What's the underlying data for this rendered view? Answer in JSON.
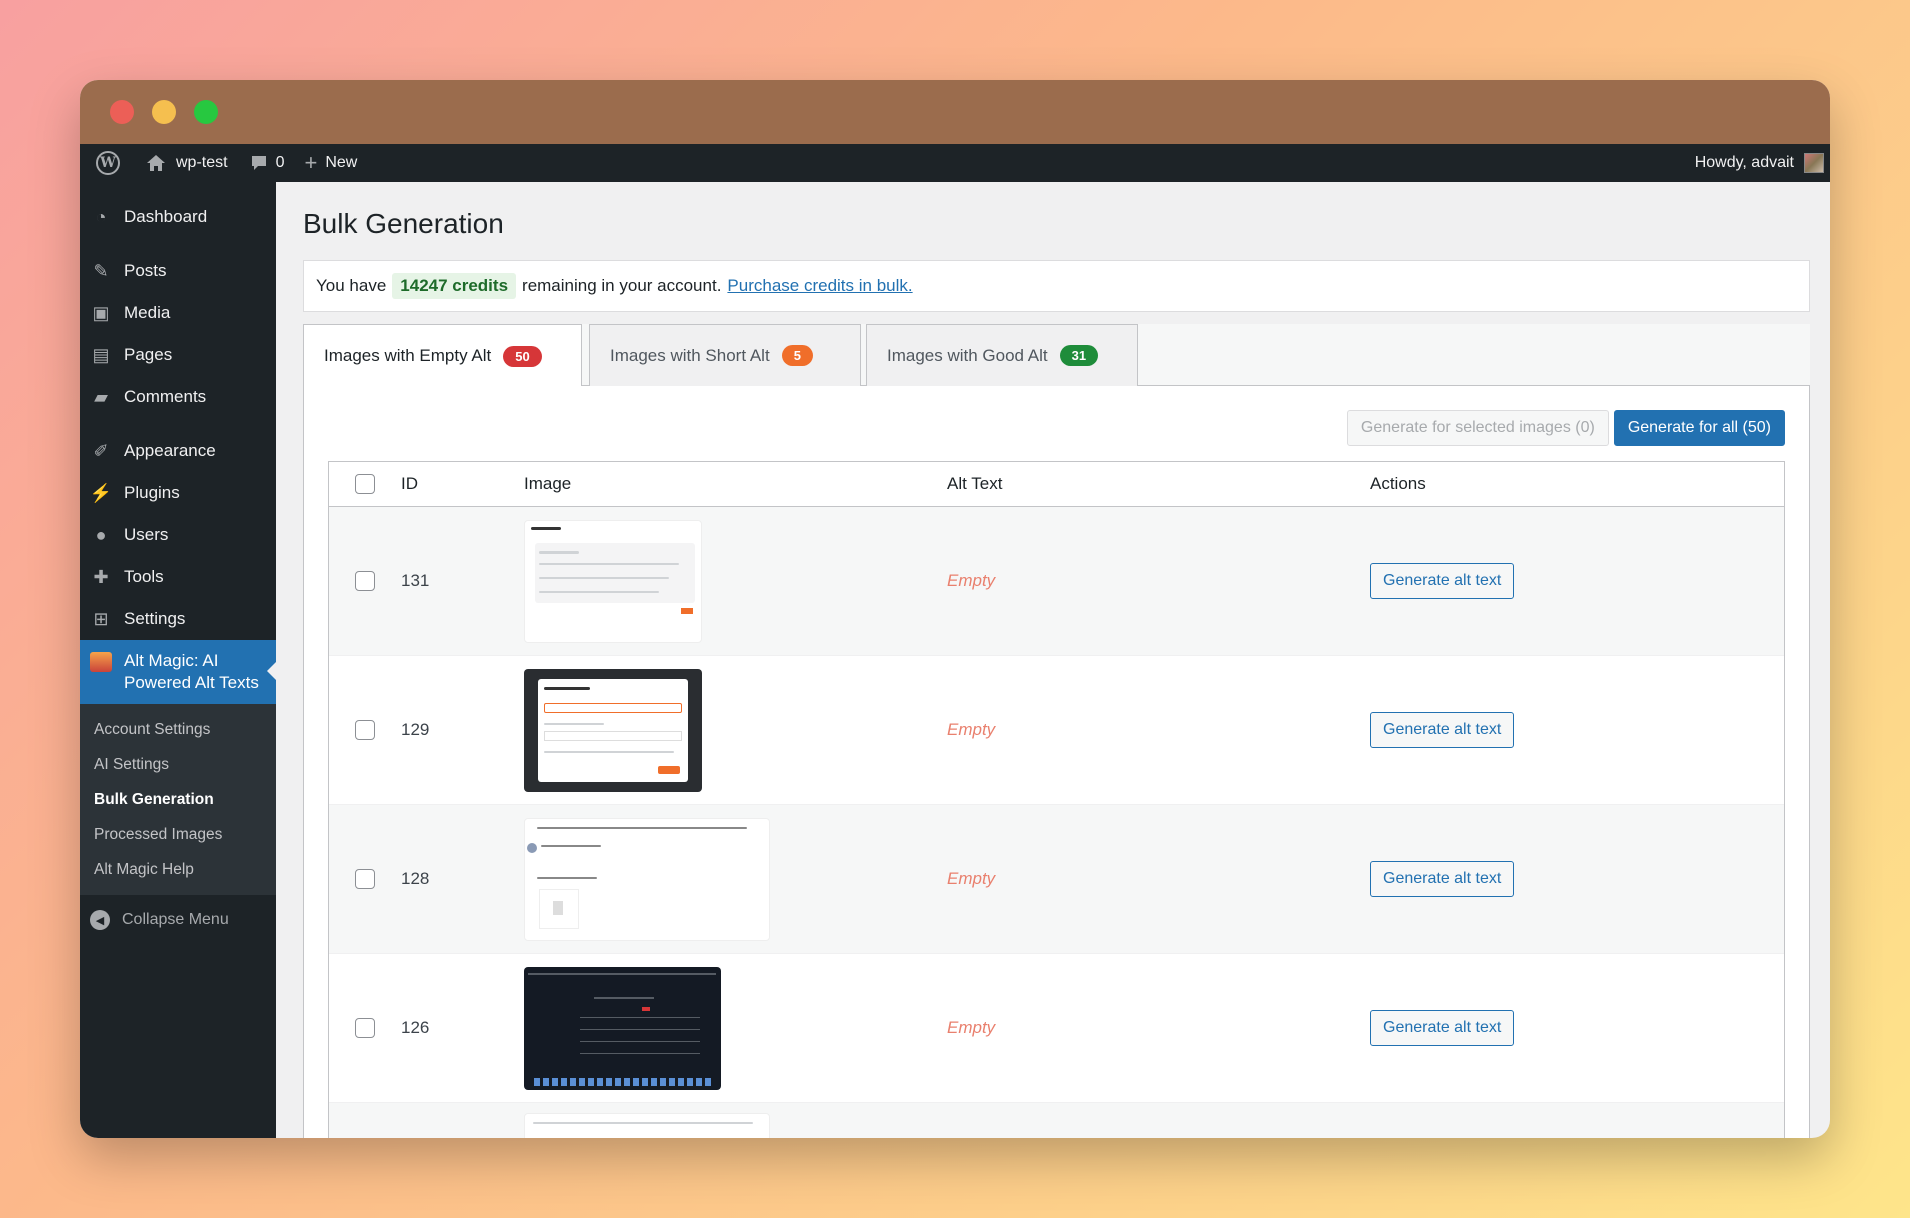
{
  "adminbar": {
    "site_name": "wp-test",
    "comments_count": "0",
    "new_label": "New",
    "greeting": "Howdy, advait"
  },
  "sidebar": {
    "items": [
      {
        "label": "Dashboard",
        "icon": "dashboard-icon"
      },
      {
        "label": "Posts",
        "icon": "pin-icon"
      },
      {
        "label": "Media",
        "icon": "media-icon"
      },
      {
        "label": "Pages",
        "icon": "pages-icon"
      },
      {
        "label": "Comments",
        "icon": "comment-icon"
      },
      {
        "label": "Appearance",
        "icon": "brush-icon"
      },
      {
        "label": "Plugins",
        "icon": "plug-icon"
      },
      {
        "label": "Users",
        "icon": "user-icon"
      },
      {
        "label": "Tools",
        "icon": "wrench-icon"
      },
      {
        "label": "Settings",
        "icon": "settings-icon"
      }
    ],
    "active": {
      "line1": "Alt Magic: AI",
      "line2": "Powered Alt Texts"
    },
    "submenu": [
      "Account Settings",
      "AI Settings",
      "Bulk Generation",
      "Processed Images",
      "Alt Magic Help"
    ],
    "collapse_label": "Collapse Menu"
  },
  "main": {
    "title": "Bulk Generation",
    "notice": {
      "prefix": "You have",
      "credits": "14247 credits",
      "middle": "remaining in your account.",
      "link": "Purchase credits in bulk."
    },
    "tabs": [
      {
        "label": "Images with Empty Alt",
        "count": "50",
        "color": "#d63638"
      },
      {
        "label": "Images with Short Alt",
        "count": "5",
        "color": "#f06e2a"
      },
      {
        "label": "Images with Good Alt",
        "count": "31",
        "color": "#1e8c3a"
      }
    ],
    "buttons": {
      "selected": "Generate for selected images (0)",
      "all": "Generate for all (50)"
    },
    "table": {
      "headers": [
        "ID",
        "Image",
        "Alt Text",
        "Actions"
      ],
      "rows": [
        {
          "id": "131",
          "alt": "Empty",
          "action": "Generate alt text"
        },
        {
          "id": "129",
          "alt": "Empty",
          "action": "Generate alt text"
        },
        {
          "id": "128",
          "alt": "Empty",
          "action": "Generate alt text"
        },
        {
          "id": "126",
          "alt": "Empty",
          "action": "Generate alt text"
        }
      ]
    }
  },
  "colors": {
    "primary": "#2271b1",
    "admin_bg": "#1d2327",
    "empty_text": "#e9806e"
  }
}
